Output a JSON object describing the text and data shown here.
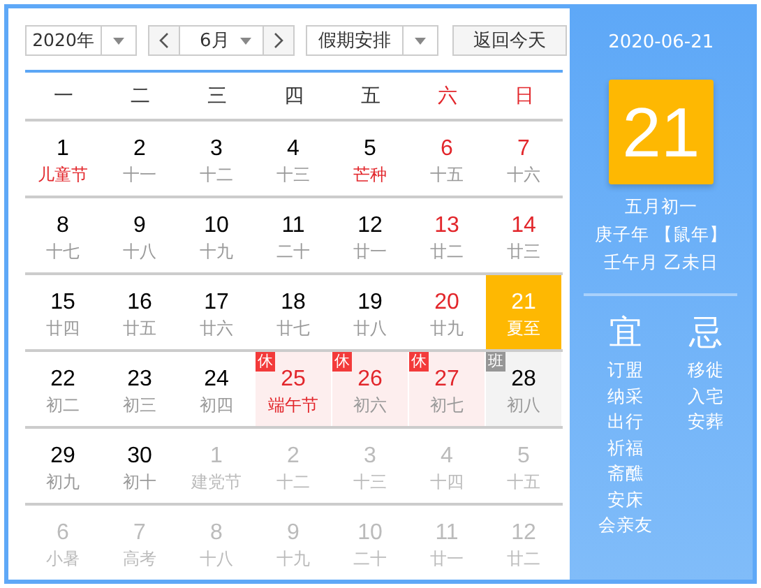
{
  "toolbar": {
    "year": "2020年",
    "month": "6月",
    "holiday": "假期安排",
    "today_button": "返回今天"
  },
  "weekdays": [
    {
      "label": "一",
      "weekend": false
    },
    {
      "label": "二",
      "weekend": false
    },
    {
      "label": "三",
      "weekend": false
    },
    {
      "label": "四",
      "weekend": false
    },
    {
      "label": "五",
      "weekend": false
    },
    {
      "label": "六",
      "weekend": true
    },
    {
      "label": "日",
      "weekend": true
    }
  ],
  "weeks": [
    [
      {
        "day": "1",
        "lunar": "儿童节",
        "festival": true,
        "selected": false
      },
      {
        "day": "2",
        "lunar": "十一",
        "selected": false
      },
      {
        "day": "3",
        "lunar": "十二",
        "selected": false
      },
      {
        "day": "4",
        "lunar": "十三",
        "selected": false
      },
      {
        "day": "5",
        "lunar": "芒种",
        "festival": true,
        "selected": false
      },
      {
        "day": "6",
        "lunar": "十五",
        "off_day": true,
        "selected": false
      },
      {
        "day": "7",
        "lunar": "十六",
        "off_day": true,
        "selected": false
      }
    ],
    [
      {
        "day": "8",
        "lunar": "十七",
        "selected": false
      },
      {
        "day": "9",
        "lunar": "十八",
        "selected": false
      },
      {
        "day": "10",
        "lunar": "十九",
        "selected": false
      },
      {
        "day": "11",
        "lunar": "二十",
        "selected": false
      },
      {
        "day": "12",
        "lunar": "廿一",
        "selected": false
      },
      {
        "day": "13",
        "lunar": "廿二",
        "off_day": true,
        "selected": false
      },
      {
        "day": "14",
        "lunar": "廿三",
        "off_day": true,
        "selected": false
      }
    ],
    [
      {
        "day": "15",
        "lunar": "廿四",
        "selected": false
      },
      {
        "day": "16",
        "lunar": "廿五",
        "selected": false
      },
      {
        "day": "17",
        "lunar": "廿六",
        "selected": false
      },
      {
        "day": "18",
        "lunar": "廿七",
        "selected": false
      },
      {
        "day": "19",
        "lunar": "廿八",
        "selected": false
      },
      {
        "day": "20",
        "lunar": "廿九",
        "off_day": true,
        "selected": false
      },
      {
        "day": "21",
        "lunar": "夏至",
        "selected": true
      }
    ],
    [
      {
        "day": "22",
        "lunar": "初二",
        "selected": false
      },
      {
        "day": "23",
        "lunar": "初三",
        "selected": false
      },
      {
        "day": "24",
        "lunar": "初四",
        "selected": false
      },
      {
        "day": "25",
        "lunar": "端午节",
        "festival": true,
        "off_day": true,
        "badge": {
          "text": "休",
          "kind": "rest"
        },
        "selected": false
      },
      {
        "day": "26",
        "lunar": "初六",
        "off_day": true,
        "badge": {
          "text": "休",
          "kind": "rest"
        },
        "selected": false
      },
      {
        "day": "27",
        "lunar": "初七",
        "off_day": true,
        "badge": {
          "text": "休",
          "kind": "rest"
        },
        "selected": false
      },
      {
        "day": "28",
        "lunar": "初八",
        "badge": {
          "text": "班",
          "kind": "work"
        },
        "selected": false
      }
    ],
    [
      {
        "day": "29",
        "lunar": "初九",
        "selected": false
      },
      {
        "day": "30",
        "lunar": "初十",
        "selected": false
      },
      {
        "day": "1",
        "lunar": "建党节",
        "other_month": true,
        "selected": false
      },
      {
        "day": "2",
        "lunar": "十二",
        "other_month": true,
        "selected": false
      },
      {
        "day": "3",
        "lunar": "十三",
        "other_month": true,
        "selected": false
      },
      {
        "day": "4",
        "lunar": "十四",
        "other_month": true,
        "selected": false
      },
      {
        "day": "5",
        "lunar": "十五",
        "other_month": true,
        "selected": false
      }
    ],
    [
      {
        "day": "6",
        "lunar": "小暑",
        "other_month": true,
        "selected": false
      },
      {
        "day": "7",
        "lunar": "高考",
        "other_month": true,
        "selected": false
      },
      {
        "day": "8",
        "lunar": "十八",
        "other_month": true,
        "selected": false
      },
      {
        "day": "9",
        "lunar": "十九",
        "other_month": true,
        "selected": false
      },
      {
        "day": "10",
        "lunar": "二十",
        "other_month": true,
        "selected": false
      },
      {
        "day": "11",
        "lunar": "廿一",
        "other_month": true,
        "selected": false
      },
      {
        "day": "12",
        "lunar": "廿二",
        "other_month": true,
        "selected": false
      }
    ]
  ],
  "side": {
    "date": "2020-06-21",
    "day": "21",
    "lunar_date": "五月初一",
    "year_ganzhi": "庚子年 【鼠年】",
    "month_day_ganzhi": "壬午月 乙未日",
    "suitable": {
      "title": "宜",
      "items": [
        "订盟",
        "纳采",
        "出行",
        "祈福",
        "斋醮",
        "安床",
        "会亲友"
      ]
    },
    "avoid": {
      "title": "忌",
      "items": [
        "移徙",
        "入宅",
        "安葬"
      ]
    }
  }
}
